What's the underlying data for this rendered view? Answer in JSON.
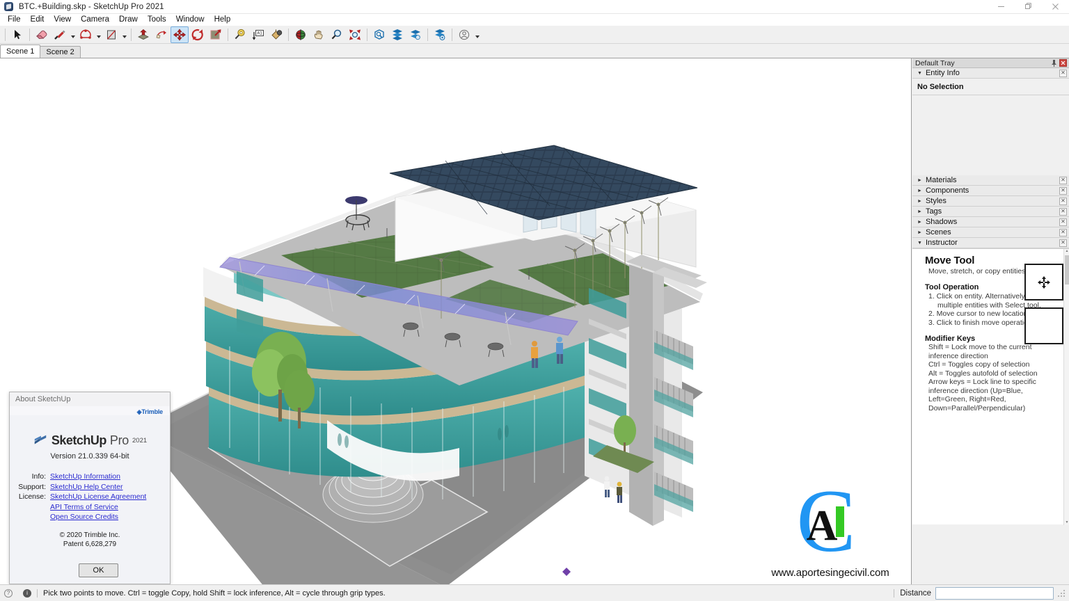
{
  "window": {
    "title": "BTC.+Building.skp - SketchUp Pro 2021",
    "app_icon": "sketchup-icon",
    "minimize_label": "Minimize",
    "maximize_label": "Restore",
    "close_label": "Close"
  },
  "menubar": {
    "items": [
      {
        "label": "File"
      },
      {
        "label": "Edit"
      },
      {
        "label": "View"
      },
      {
        "label": "Camera"
      },
      {
        "label": "Draw"
      },
      {
        "label": "Tools"
      },
      {
        "label": "Window"
      },
      {
        "label": "Help"
      }
    ]
  },
  "toolbar": {
    "tools": [
      {
        "name": "select-tool",
        "icon": "arrow-cursor-icon",
        "active": false
      },
      {
        "name": "eraser-tool",
        "icon": "eraser-icon",
        "active": false
      },
      {
        "name": "line-tool",
        "icon": "pencil-icon",
        "active": false
      },
      {
        "name": "arc-tool",
        "icon": "arc-icon",
        "active": false
      },
      {
        "name": "rectangle-tool",
        "icon": "rectangle-icon",
        "active": false
      },
      {
        "name": "pushpull-tool",
        "icon": "pushpull-icon",
        "active": false
      },
      {
        "name": "followme-tool",
        "icon": "followme-icon",
        "active": false
      },
      {
        "name": "move-tool",
        "icon": "move-icon",
        "active": true
      },
      {
        "name": "rotate-tool",
        "icon": "rotate-icon",
        "active": false
      },
      {
        "name": "scale-tool",
        "icon": "scale-icon",
        "active": false
      },
      {
        "name": "tape-measure-tool",
        "icon": "tape-measure-icon",
        "active": false
      },
      {
        "name": "dimension-tool",
        "icon": "dimension-icon",
        "active": false
      },
      {
        "name": "paint-bucket-tool",
        "icon": "paint-bucket-icon",
        "active": false
      },
      {
        "name": "orbit-tool",
        "icon": "orbit-icon",
        "active": false
      },
      {
        "name": "pan-tool",
        "icon": "hand-icon",
        "active": false
      },
      {
        "name": "zoom-tool",
        "icon": "magnifier-icon",
        "active": false
      },
      {
        "name": "zoom-extents-tool",
        "icon": "zoom-extents-icon",
        "active": false
      },
      {
        "name": "3d-warehouse-button",
        "icon": "warehouse-icon",
        "active": false
      },
      {
        "name": "extension-warehouse-button",
        "icon": "extension-warehouse-icon",
        "active": false
      },
      {
        "name": "extension-manager-button",
        "icon": "extension-manager-icon",
        "active": false
      },
      {
        "name": "trimble-connect-button",
        "icon": "trimble-connect-icon",
        "active": false
      },
      {
        "name": "account-button",
        "icon": "user-account-icon",
        "active": false
      }
    ]
  },
  "scenes": {
    "tabs": [
      {
        "label": "Scene 1",
        "selected": true
      },
      {
        "label": "Scene 2",
        "selected": false
      }
    ]
  },
  "viewport": {
    "model_name": "BTC Building",
    "watermark_url": "www.aportesingecivil.com",
    "watermark_letters": {
      "c": "C",
      "a": "A",
      "i": "I"
    },
    "colors": {
      "glass_teal": "#3a9a9a",
      "glass_blue": "#6f86d8",
      "glass_violet": "#9f8fd6",
      "slab_tan": "#cbb894",
      "concrete_gray": "#9a9a9a",
      "plaza_gray": "#8e8e8e",
      "roof_green": "#4c6b3f",
      "solar_panel": "#2d3f52",
      "wall_white": "#f1f1f1",
      "tree_green": "#6fa843"
    }
  },
  "about_dialog": {
    "title": "About SketchUp",
    "brand": "Trimble",
    "product_name": "SketchUp",
    "product_edition": "Pro",
    "product_year": "2021",
    "version": "Version 21.0.339 64-bit",
    "links": [
      {
        "label": "Info:",
        "link": "SketchUp Information"
      },
      {
        "label": "Support:",
        "link": "SketchUp Help Center"
      },
      {
        "label": "License:",
        "link": "SketchUp License Agreement"
      },
      {
        "label": "",
        "link": "API Terms of Service"
      },
      {
        "label": "",
        "link": "Open Source Credits"
      }
    ],
    "copyright": "© 2020 Trimble Inc.",
    "patent": "Patent 6,628,279",
    "ok_label": "OK"
  },
  "tray": {
    "title": "Default Tray",
    "pin_icon": "pin-icon",
    "close_icon": "close-icon",
    "entity_info": {
      "label": "Entity Info",
      "expanded": true,
      "content": "No Selection"
    },
    "panels": [
      {
        "label": "Materials",
        "expanded": false
      },
      {
        "label": "Components",
        "expanded": false
      },
      {
        "label": "Styles",
        "expanded": false
      },
      {
        "label": "Tags",
        "expanded": false
      },
      {
        "label": "Shadows",
        "expanded": false
      },
      {
        "label": "Scenes",
        "expanded": false
      },
      {
        "label": "Instructor",
        "expanded": true
      }
    ],
    "instructor": {
      "tool_title": "Move Tool",
      "tool_subtitle": "Move, stretch, or copy entities.",
      "operation_heading": "Tool Operation",
      "operation_steps": [
        "1. Click on entity. Alternatively, pre-select multiple entities with Select tool.",
        "2. Move cursor to new location.",
        "3. Click to finish move operation."
      ],
      "modifier_heading": "Modifier Keys",
      "modifier_lines": [
        "Shift = Lock move to the current inference direction",
        "Ctrl = Toggles copy of selection",
        "Alt = Toggles autofold of selection",
        "Arrow keys = Lock line to specific inference direction (Up=Blue, Left=Green, Right=Red, Down=Parallel/Perpendicular)"
      ]
    }
  },
  "statusbar": {
    "help_icon": "question-circle-icon",
    "info_icon": "info-circle-icon",
    "message": "Pick two points to move.  Ctrl = toggle Copy, hold Shift = lock inference, Alt = cycle through grip types.",
    "measurement_label": "Distance",
    "measurement_value": "",
    "measurement_placeholder": ""
  }
}
